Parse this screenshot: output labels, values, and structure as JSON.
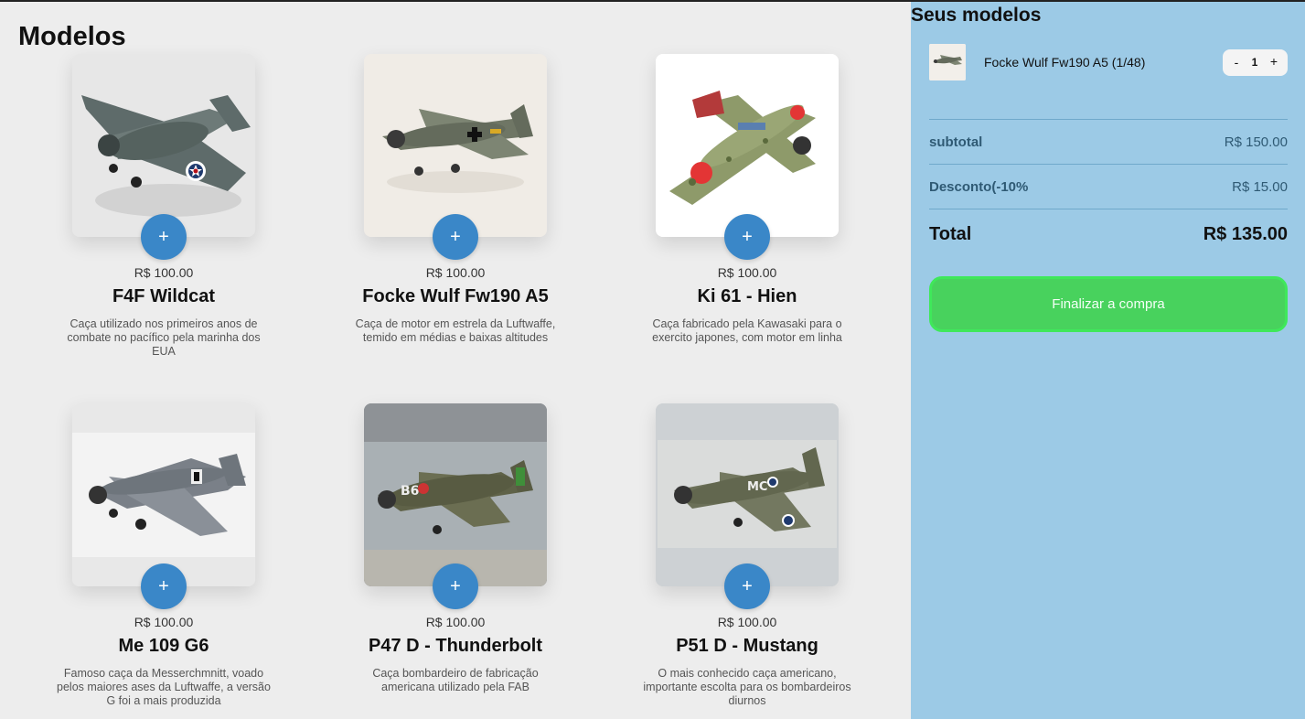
{
  "main": {
    "title": "Modelos",
    "products": [
      {
        "price": "R$ 100.00",
        "name": "F4F Wildcat",
        "description": "Caça utilizado nos primeiros anos de combate no pacífico pela marinha dos EUA",
        "add_label": "+",
        "icon": "plane-f4f-wildcat",
        "bg": "#e7e7e7"
      },
      {
        "price": "R$ 100.00",
        "name": "Focke Wulf Fw190 A5",
        "description": "Caça de motor em estrela da Luftwaffe, temido em médias e baixas altitudes",
        "add_label": "+",
        "icon": "plane-fw190",
        "bg": "#f0ece6"
      },
      {
        "price": "R$ 100.00",
        "name": "Ki 61 - Hien",
        "description": "Caça fabricado pela Kawasaki para o exercito japones, com motor em linha",
        "add_label": "+",
        "icon": "plane-ki61",
        "bg": "#ffffff"
      },
      {
        "price": "R$ 100.00",
        "name": "Me 109 G6",
        "description": "Famoso caça da Messerchmnitt, voado pelos maiores ases da Luftwaffe, a versão G foi a mais produzida",
        "add_label": "+",
        "icon": "plane-me109",
        "bg": "#e8e8e8"
      },
      {
        "price": "R$ 100.00",
        "name": "P47 D - Thunderbolt",
        "description": "Caça bombardeiro de fabricação americana utilizado pela FAB",
        "add_label": "+",
        "icon": "plane-p47",
        "bg": "#8e9296"
      },
      {
        "price": "R$ 100.00",
        "name": "P51 D - Mustang",
        "description": "O mais conhecido caça americano, importante escolta para os bombardeiros diurnos",
        "add_label": "+",
        "icon": "plane-p51",
        "bg": "#cdd1d4"
      }
    ]
  },
  "cart": {
    "title": "Seus modelos",
    "items": [
      {
        "name": "Focke Wulf Fw190 A5 (1/48)",
        "qty": "1",
        "minus": "-",
        "plus": "+"
      }
    ],
    "subtotal_label": "subtotal",
    "subtotal_value": "R$ 150.00",
    "discount_label": "Desconto(-10%",
    "discount_value": "R$ 15.00",
    "total_label": "Total",
    "total_value": "R$ 135.00",
    "checkout_label": "Finalizar a compra"
  },
  "colors": {
    "accent": "#3a87c8",
    "sidebar": "#9ccae6",
    "checkout": "#48d25d"
  }
}
